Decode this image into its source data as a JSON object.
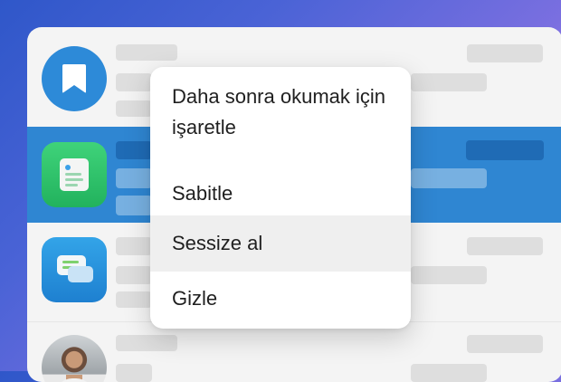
{
  "context_menu": {
    "items": [
      {
        "label": "Daha sonra okumak için işaretle"
      },
      {
        "label": "Sabitle"
      },
      {
        "label": "Sessize al",
        "state": "highlighted"
      },
      {
        "label": "Gizle"
      }
    ]
  },
  "list": {
    "rows": [
      {
        "icon": "bookmark-icon",
        "selected": false
      },
      {
        "icon": "news-app-icon",
        "selected": true
      },
      {
        "icon": "chat-bubbles-icon",
        "selected": false
      },
      {
        "icon": "user-avatar-photo",
        "selected": false
      }
    ]
  },
  "colors": {
    "selected_row": "#2f86d2",
    "bookmark_circle": "#2d8ad8",
    "menu_highlight": "#efefef"
  }
}
